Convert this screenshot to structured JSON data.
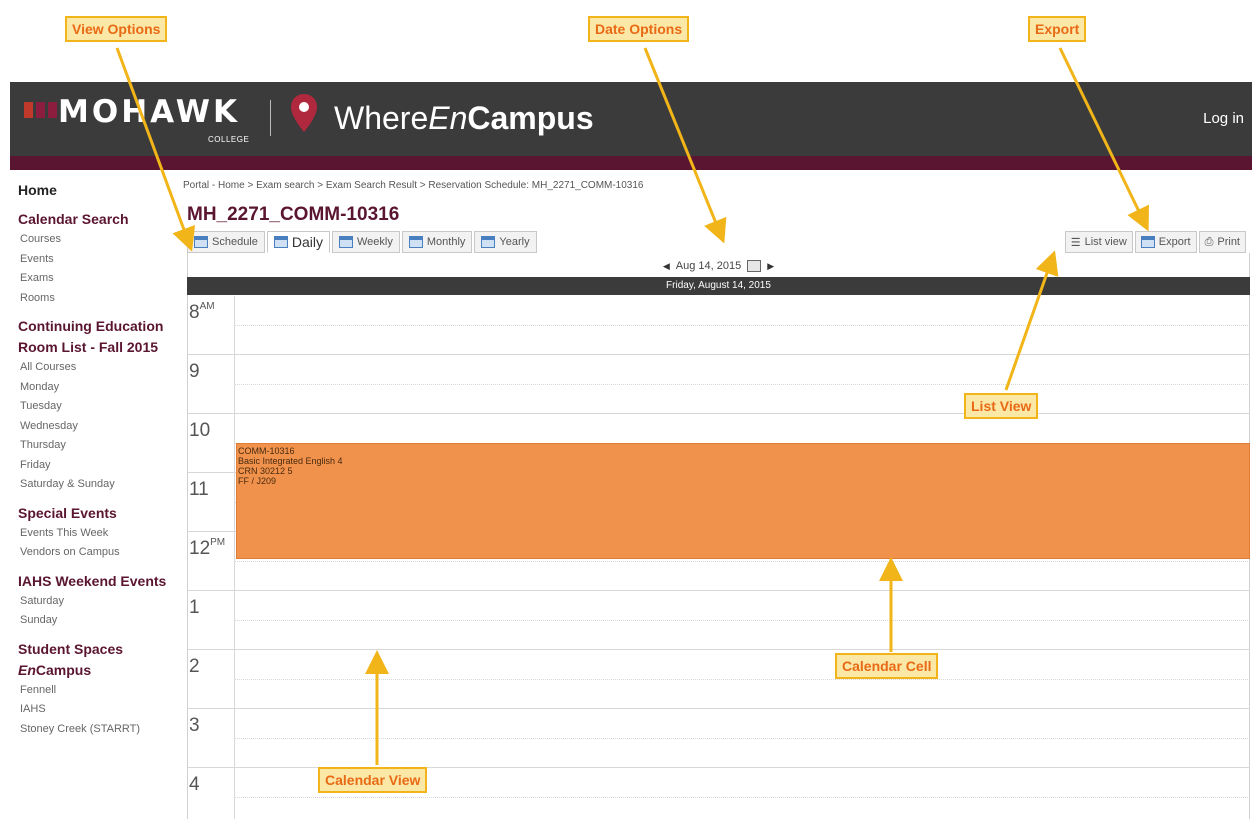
{
  "header": {
    "brand": "MOHAWK",
    "college": "COLLEGE",
    "app_prefix": "Where",
    "app_en": "En",
    "app_campus": "Campus",
    "login": "Log in"
  },
  "sidebar": {
    "home": "Home",
    "calendar_search": {
      "title": "Calendar Search",
      "items": [
        "Courses",
        "Events",
        "Exams",
        "Rooms"
      ]
    },
    "continuing": {
      "title": "Continuing Education Room List - Fall 2015",
      "items": [
        "All Courses",
        "Monday",
        "Tuesday",
        "Wednesday",
        "Thursday",
        "Friday",
        "Saturday & Sunday"
      ]
    },
    "special": {
      "title": "Special Events",
      "items": [
        "Events This Week",
        "Vendors on Campus"
      ]
    },
    "iahs": {
      "title": "IAHS Weekend Events",
      "items": [
        "Saturday",
        "Sunday"
      ]
    },
    "student": {
      "title_a": "Student Spaces",
      "title_en": "En",
      "title_b": "Campus",
      "items": [
        "Fennell",
        "IAHS",
        "Stoney Creek (STARRT)"
      ]
    }
  },
  "breadcrumb": "Portal - Home > Exam search > Exam Search Result > Reservation Schedule: MH_2271_COMM-10316",
  "page_title": "MH_2271_COMM-10316",
  "tabs": [
    "Schedule",
    "Daily",
    "Weekly",
    "Monthly",
    "Yearly"
  ],
  "active_tab": "Daily",
  "tools": [
    "List view",
    "Export",
    "Print"
  ],
  "date_nav": {
    "date": "Aug 14, 2015"
  },
  "day_header": "Friday, August 14, 2015",
  "hours": [
    {
      "n": "8",
      "s": "AM"
    },
    {
      "n": "9",
      "s": ""
    },
    {
      "n": "10",
      "s": ""
    },
    {
      "n": "11",
      "s": ""
    },
    {
      "n": "12",
      "s": "PM"
    },
    {
      "n": "1",
      "s": ""
    },
    {
      "n": "2",
      "s": ""
    },
    {
      "n": "3",
      "s": ""
    },
    {
      "n": "4",
      "s": ""
    }
  ],
  "event": {
    "lines": [
      "COMM-10316",
      "Basic Integrated English 4",
      "CRN  30212 5",
      "FF / J209"
    ]
  },
  "annotations": {
    "view_options": "View Options",
    "date_options": "Date Options",
    "export": "Export",
    "list_view": "List View",
    "calendar_cell": "Calendar Cell",
    "calendar_view": "Calendar View"
  },
  "colors": {
    "header": "#3b3b3b",
    "maroon": "#5a1530",
    "event": "#f0924c",
    "callout_border": "#f1b519",
    "callout_text": "#e86a15"
  }
}
